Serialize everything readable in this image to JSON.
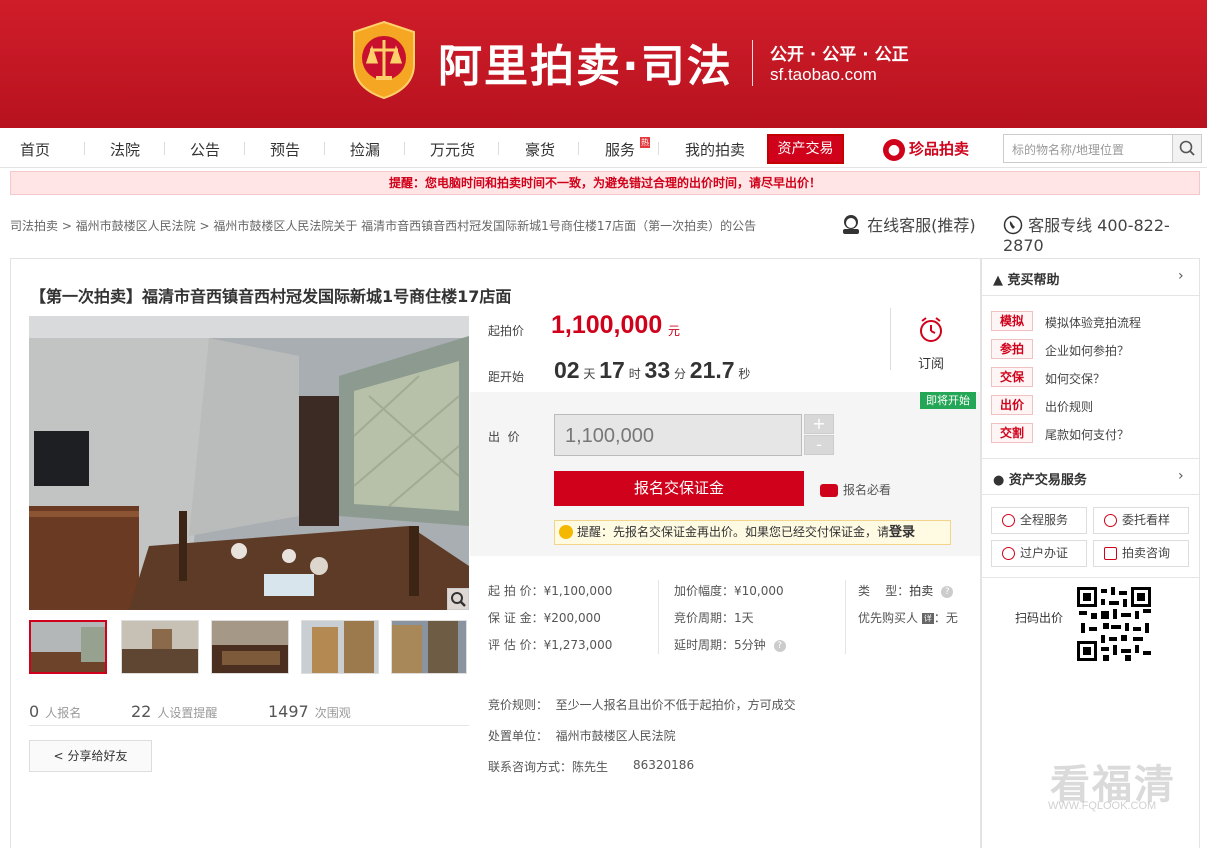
{
  "header": {
    "title": "阿里拍卖·司法",
    "slogan": "公开 · 公平 · 公正",
    "domain": "sf.taobao.com"
  },
  "nav": {
    "items": [
      "首页",
      "法院",
      "公告",
      "预告",
      "捡漏",
      "万元货",
      "豪货",
      "服务",
      "我的拍卖"
    ],
    "hot_badge": "热",
    "asset_trade": "资产交易",
    "zhenpin": "珍品拍卖",
    "search_placeholder": "标的物名称/地理位置"
  },
  "warning": "提醒：您电脑时间和拍卖时间不一致，为避免错过合理的出价时间，请尽早出价！",
  "breadcrumb": "司法拍卖 > 福州市鼓楼区人民法院 > 福州市鼓楼区人民法院关于 福清市音西镇音西村冠发国际新城1号商住楼17店面（第一次拍卖）的公告",
  "service": {
    "online": "在线客服(推荐)",
    "hotline": "客服专线 400-822-2870"
  },
  "item": {
    "title": "【第一次拍卖】福清市音西镇音西村冠发国际新城1号商住楼17店面"
  },
  "price": {
    "start_label": "起拍价",
    "start_value": "1,100,000",
    "unit": "元",
    "countdown_label": "距开始",
    "days": "02",
    "days_unit": "天",
    "hours": "17",
    "hours_unit": "时",
    "minutes": "33",
    "minutes_unit": "分",
    "seconds": "21.7",
    "seconds_unit": "秒",
    "subscribe": "订阅"
  },
  "bid": {
    "badge": "即将开始",
    "label": "出  价",
    "input_value": "1,100,000",
    "plus": "+",
    "minus": "-",
    "register": "报名交保证金",
    "must_see": "报名必看",
    "tip_prefix": "提醒：先报名交保证金再出价。如果您已经交付保证金，请",
    "tip_login": "登录"
  },
  "info": {
    "start_price": "起 拍 价：¥1,100,000",
    "deposit": "保 证 金：¥200,000",
    "assess": "评 估 价：¥1,273,000",
    "increment": "加价幅度：¥10,000",
    "cycle": "竞价周期：1天",
    "delay": "延时周期：5分钟",
    "type_label": "类    型：",
    "type_value": "拍卖",
    "priority_label": "优先购买人",
    "priority_icon": "详",
    "priority_value": "：无",
    "rule": "竞价规则：  至少一人报名且出价不低于起拍价，方可成交",
    "unit": "处置单位：  福州市鼓楼区人民法院",
    "contact": "联系咨询方式：陈先生",
    "phone": "86320186"
  },
  "stats": {
    "signup_count": "0",
    "signup_label": "人报名",
    "remind_count": "22",
    "remind_label": "人设置提醒",
    "view_count": "1497",
    "view_label": "次围观"
  },
  "share": "分享给好友",
  "sidebar": {
    "help_title": "竞买帮助",
    "help_items": [
      {
        "tag": "模拟",
        "text": "模拟体验竞拍流程"
      },
      {
        "tag": "参拍",
        "text": "企业如何参拍？"
      },
      {
        "tag": "交保",
        "text": "如何交保？"
      },
      {
        "tag": "出价",
        "text": "出价规则"
      },
      {
        "tag": "交割",
        "text": "尾款如何支付？"
      }
    ],
    "asset_title": "资产交易服务",
    "services": [
      "全程服务",
      "委托看样",
      "过户办证",
      "拍卖咨询"
    ],
    "qr_label": "扫码出价"
  },
  "watermark": {
    "text": "看福清",
    "url": "WWW.FQLOOK.COM"
  },
  "colors": {
    "brand": "#d0021b",
    "soon": "#23a655"
  }
}
